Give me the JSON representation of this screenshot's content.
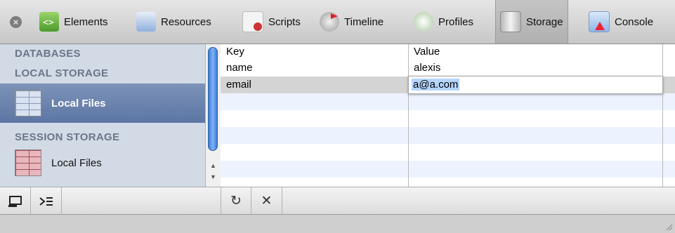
{
  "toolbar": {
    "tabs": [
      {
        "label": "Elements",
        "icon": "elements-icon"
      },
      {
        "label": "Resources",
        "icon": "resources-icon"
      },
      {
        "label": "Scripts",
        "icon": "scripts-icon"
      },
      {
        "label": "Timeline",
        "icon": "timeline-icon"
      },
      {
        "label": "Profiles",
        "icon": "profiles-icon"
      },
      {
        "label": "Storage",
        "icon": "storage-icon",
        "active": true
      },
      {
        "label": "Console",
        "icon": "console-icon"
      }
    ]
  },
  "sidebar": {
    "databases_heading": "DATABASES",
    "local_storage_heading": "LOCAL STORAGE",
    "local_item": "Local Files",
    "session_storage_heading": "SESSION STORAGE",
    "session_item": "Local Files"
  },
  "grid": {
    "headers": [
      "Key",
      "Value"
    ],
    "rows": [
      {
        "key": "name",
        "value": "alexis"
      },
      {
        "key": "email",
        "value": "a@a.com"
      }
    ],
    "editing_value": "a@a.com"
  },
  "colors": {
    "selection": "#5c76a4",
    "sidebar_bg": "#d2dae5",
    "row_alt": "#edf3fe",
    "edit_highlight": "#b5d5fd"
  }
}
